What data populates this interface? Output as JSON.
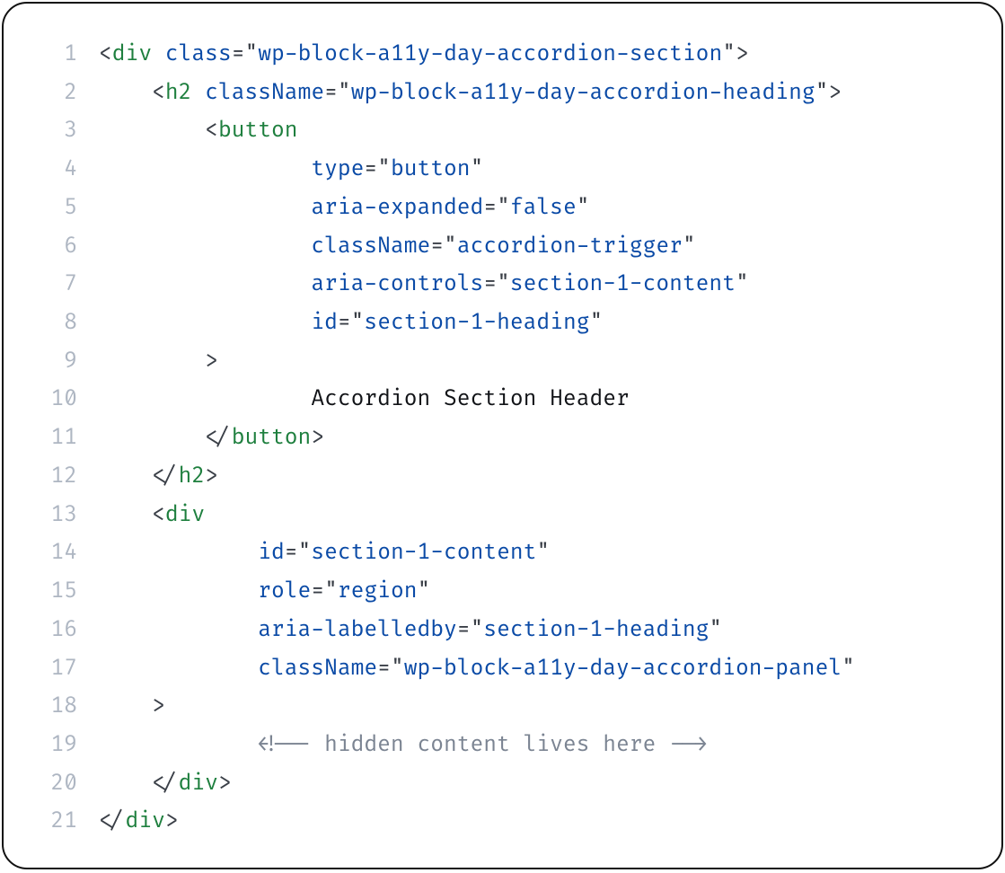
{
  "code": {
    "language": "html-jsx",
    "lines": [
      {
        "n": 1,
        "indent": 0,
        "tokens": [
          {
            "t": "punc",
            "v": "<"
          },
          {
            "t": "tag",
            "v": "div"
          },
          {
            "t": "text",
            "v": " "
          },
          {
            "t": "attr",
            "v": "class"
          },
          {
            "t": "punc",
            "v": "="
          },
          {
            "t": "punc",
            "v": "\""
          },
          {
            "t": "str",
            "v": "wp-block-a11y-day-accordion-section"
          },
          {
            "t": "punc",
            "v": "\""
          },
          {
            "t": "punc",
            "v": ">"
          }
        ]
      },
      {
        "n": 2,
        "indent": 1,
        "tokens": [
          {
            "t": "punc",
            "v": "<"
          },
          {
            "t": "tag",
            "v": "h2"
          },
          {
            "t": "text",
            "v": " "
          },
          {
            "t": "attr",
            "v": "className"
          },
          {
            "t": "punc",
            "v": "="
          },
          {
            "t": "punc",
            "v": "\""
          },
          {
            "t": "str",
            "v": "wp-block-a11y-day-accordion-heading"
          },
          {
            "t": "punc",
            "v": "\""
          },
          {
            "t": "punc",
            "v": ">"
          }
        ]
      },
      {
        "n": 3,
        "indent": 2,
        "tokens": [
          {
            "t": "punc",
            "v": "<"
          },
          {
            "t": "tag",
            "v": "button"
          }
        ]
      },
      {
        "n": 4,
        "indent": 4,
        "tokens": [
          {
            "t": "attr",
            "v": "type"
          },
          {
            "t": "punc",
            "v": "="
          },
          {
            "t": "punc",
            "v": "\""
          },
          {
            "t": "str",
            "v": "button"
          },
          {
            "t": "punc",
            "v": "\""
          }
        ]
      },
      {
        "n": 5,
        "indent": 4,
        "tokens": [
          {
            "t": "attr",
            "v": "aria-expanded"
          },
          {
            "t": "punc",
            "v": "="
          },
          {
            "t": "punc",
            "v": "\""
          },
          {
            "t": "str",
            "v": "false"
          },
          {
            "t": "punc",
            "v": "\""
          }
        ]
      },
      {
        "n": 6,
        "indent": 4,
        "tokens": [
          {
            "t": "attr",
            "v": "className"
          },
          {
            "t": "punc",
            "v": "="
          },
          {
            "t": "punc",
            "v": "\""
          },
          {
            "t": "str",
            "v": "accordion-trigger"
          },
          {
            "t": "punc",
            "v": "\""
          }
        ]
      },
      {
        "n": 7,
        "indent": 4,
        "tokens": [
          {
            "t": "attr",
            "v": "aria-controls"
          },
          {
            "t": "punc",
            "v": "="
          },
          {
            "t": "punc",
            "v": "\""
          },
          {
            "t": "str",
            "v": "section-1-content"
          },
          {
            "t": "punc",
            "v": "\""
          }
        ]
      },
      {
        "n": 8,
        "indent": 4,
        "tokens": [
          {
            "t": "attr",
            "v": "id"
          },
          {
            "t": "punc",
            "v": "="
          },
          {
            "t": "punc",
            "v": "\""
          },
          {
            "t": "str",
            "v": "section-1-heading"
          },
          {
            "t": "punc",
            "v": "\""
          }
        ]
      },
      {
        "n": 9,
        "indent": 2,
        "tokens": [
          {
            "t": "punc",
            "v": ">"
          }
        ]
      },
      {
        "n": 10,
        "indent": 4,
        "tokens": [
          {
            "t": "text",
            "v": "Accordion Section Header"
          }
        ]
      },
      {
        "n": 11,
        "indent": 2,
        "tokens": [
          {
            "t": "punc",
            "v": "</"
          },
          {
            "t": "tag",
            "v": "button"
          },
          {
            "t": "punc",
            "v": ">"
          }
        ]
      },
      {
        "n": 12,
        "indent": 1,
        "tokens": [
          {
            "t": "punc",
            "v": "</"
          },
          {
            "t": "tag",
            "v": "h2"
          },
          {
            "t": "punc",
            "v": ">"
          }
        ]
      },
      {
        "n": 13,
        "indent": 1,
        "tokens": [
          {
            "t": "punc",
            "v": "<"
          },
          {
            "t": "tag",
            "v": "div"
          }
        ]
      },
      {
        "n": 14,
        "indent": 3,
        "tokens": [
          {
            "t": "attr",
            "v": "id"
          },
          {
            "t": "punc",
            "v": "="
          },
          {
            "t": "punc",
            "v": "\""
          },
          {
            "t": "str",
            "v": "section-1-content"
          },
          {
            "t": "punc",
            "v": "\""
          }
        ]
      },
      {
        "n": 15,
        "indent": 3,
        "tokens": [
          {
            "t": "attr",
            "v": "role"
          },
          {
            "t": "punc",
            "v": "="
          },
          {
            "t": "punc",
            "v": "\""
          },
          {
            "t": "str",
            "v": "region"
          },
          {
            "t": "punc",
            "v": "\""
          }
        ]
      },
      {
        "n": 16,
        "indent": 3,
        "tokens": [
          {
            "t": "attr",
            "v": "aria-labelledby"
          },
          {
            "t": "punc",
            "v": "="
          },
          {
            "t": "punc",
            "v": "\""
          },
          {
            "t": "str",
            "v": "section-1-heading"
          },
          {
            "t": "punc",
            "v": "\""
          }
        ]
      },
      {
        "n": 17,
        "indent": 3,
        "tokens": [
          {
            "t": "attr",
            "v": "className"
          },
          {
            "t": "punc",
            "v": "="
          },
          {
            "t": "punc",
            "v": "\""
          },
          {
            "t": "str",
            "v": "wp-block-a11y-day-accordion-panel"
          },
          {
            "t": "punc",
            "v": "\""
          }
        ]
      },
      {
        "n": 18,
        "indent": 1,
        "tokens": [
          {
            "t": "punc",
            "v": ">"
          }
        ]
      },
      {
        "n": 19,
        "indent": 3,
        "tokens": [
          {
            "t": "comm",
            "v": "<!-- hidden content lives here -->"
          }
        ]
      },
      {
        "n": 20,
        "indent": 1,
        "tokens": [
          {
            "t": "punc",
            "v": "</"
          },
          {
            "t": "tag",
            "v": "div"
          },
          {
            "t": "punc",
            "v": ">"
          }
        ]
      },
      {
        "n": 21,
        "indent": 0,
        "tokens": [
          {
            "t": "punc",
            "v": "</"
          },
          {
            "t": "tag",
            "v": "div"
          },
          {
            "t": "punc",
            "v": ">"
          }
        ]
      }
    ]
  }
}
